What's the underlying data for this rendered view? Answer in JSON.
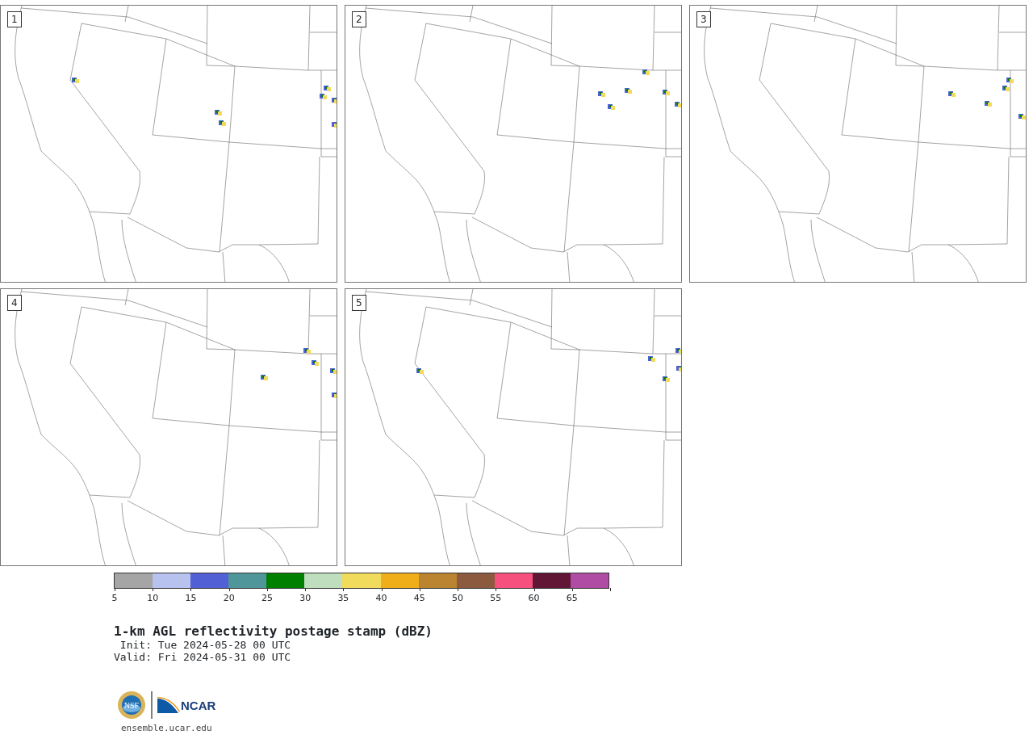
{
  "panels": [
    {
      "label": "1"
    },
    {
      "label": "2"
    },
    {
      "label": "3"
    },
    {
      "label": "4"
    },
    {
      "label": "5"
    }
  ],
  "colorbar": {
    "bins": [
      {
        "color": "#a5a5a5"
      },
      {
        "color": "#b7c2ee"
      },
      {
        "color": "#5260d6"
      },
      {
        "color": "#4f969b"
      },
      {
        "color": "#008000"
      },
      {
        "color": "#bfdebe"
      },
      {
        "color": "#f1db5c"
      },
      {
        "color": "#f0ae1a"
      },
      {
        "color": "#bb8431"
      },
      {
        "color": "#8c5a3e"
      },
      {
        "color": "#f5507e"
      },
      {
        "color": "#601634"
      },
      {
        "color": "#b04ca4"
      }
    ],
    "ticks": [
      "5",
      "10",
      "15",
      "20",
      "25",
      "30",
      "35",
      "40",
      "45",
      "50",
      "55",
      "60",
      "65"
    ]
  },
  "title": "1-km AGL reflectivity postage stamp (dBZ)",
  "init": " Init: Tue 2024-05-28 00 UTC",
  "valid": "Valid: Fri 2024-05-31 00 UTC",
  "footer": {
    "seal_text": "NSF",
    "logo_text": "NCAR",
    "url": "ensemble.ucar.edu"
  }
}
